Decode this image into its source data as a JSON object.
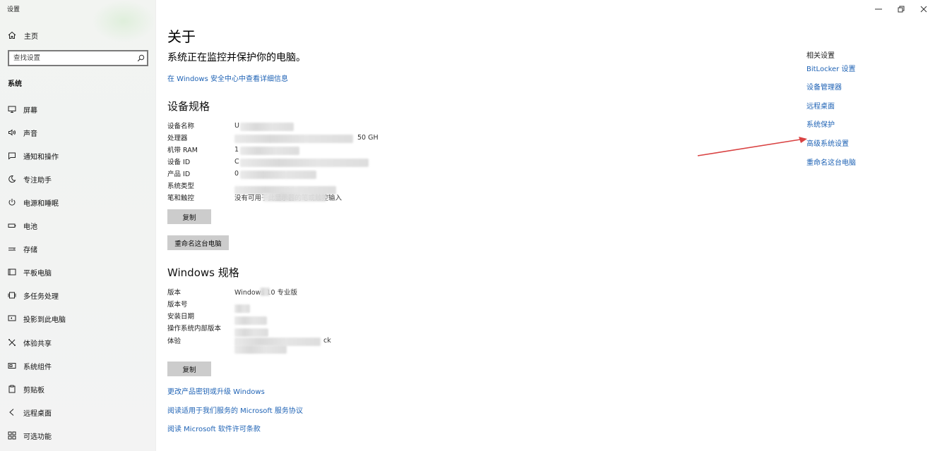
{
  "window": {
    "title": "设置",
    "minimize_icon": "minimize-icon",
    "restore_icon": "restore-icon",
    "close_icon": "close-icon"
  },
  "sidebar": {
    "home_label": "主页",
    "search_placeholder": "查找设置",
    "section_label": "系统",
    "items": [
      {
        "label": "屏幕",
        "icon": "monitor-icon"
      },
      {
        "label": "声音",
        "icon": "speaker-icon"
      },
      {
        "label": "通知和操作",
        "icon": "notification-icon"
      },
      {
        "label": "专注助手",
        "icon": "moon-icon"
      },
      {
        "label": "电源和睡眠",
        "icon": "power-icon"
      },
      {
        "label": "电池",
        "icon": "battery-icon"
      },
      {
        "label": "存储",
        "icon": "storage-icon"
      },
      {
        "label": "平板电脑",
        "icon": "tablet-icon"
      },
      {
        "label": "多任务处理",
        "icon": "multitask-icon"
      },
      {
        "label": "投影到此电脑",
        "icon": "project-icon"
      },
      {
        "label": "体验共享",
        "icon": "share-icon"
      },
      {
        "label": "系统组件",
        "icon": "components-icon"
      },
      {
        "label": "剪贴板",
        "icon": "clipboard-icon"
      },
      {
        "label": "远程桌面",
        "icon": "remote-desktop-icon"
      },
      {
        "label": "可选功能",
        "icon": "optional-features-icon"
      }
    ]
  },
  "main": {
    "title": "关于",
    "protect_text": "系统正在监控并保护你的电脑。",
    "security_link": "在 Windows 安全中心中查看详细信息",
    "device_specs": {
      "heading": "设备规格",
      "rows": [
        {
          "key": "设备名称",
          "value": "U"
        },
        {
          "key": "处理器",
          "value": "50 GH"
        },
        {
          "key": "机带 RAM",
          "value": "1"
        },
        {
          "key": "设备 ID",
          "value": "C"
        },
        {
          "key": "产品 ID",
          "value": "0"
        },
        {
          "key": "系统类型",
          "value": ""
        },
        {
          "key": "笔和触控",
          "value": "没有可用于此显示器的笔或触控输入"
        }
      ],
      "copy_button": "复制",
      "rename_button": "重命名这台电脑"
    },
    "windows_specs": {
      "heading": "Windows 规格",
      "rows": [
        {
          "key": "版本",
          "value": "Windows 10 专业版"
        },
        {
          "key": "版本号",
          "value": ""
        },
        {
          "key": "安装日期",
          "value": ""
        },
        {
          "key": "操作系统内部版本",
          "value": ""
        },
        {
          "key": "体验",
          "value": "ck"
        }
      ],
      "copy_button": "复制"
    },
    "bottom_links": [
      "更改产品密钥或升级 Windows",
      "阅读适用于我们服务的 Microsoft 服务协议",
      "阅读 Microsoft 软件许可条款"
    ]
  },
  "related": {
    "title": "相关设置",
    "links": [
      "BitLocker 设置",
      "设备管理器",
      "远程桌面",
      "系统保护",
      "高级系统设置",
      "重命名这台电脑"
    ]
  },
  "colors": {
    "link": "#1f63b5",
    "button": "#cccccc",
    "annotation_arrow": "#d94242"
  }
}
